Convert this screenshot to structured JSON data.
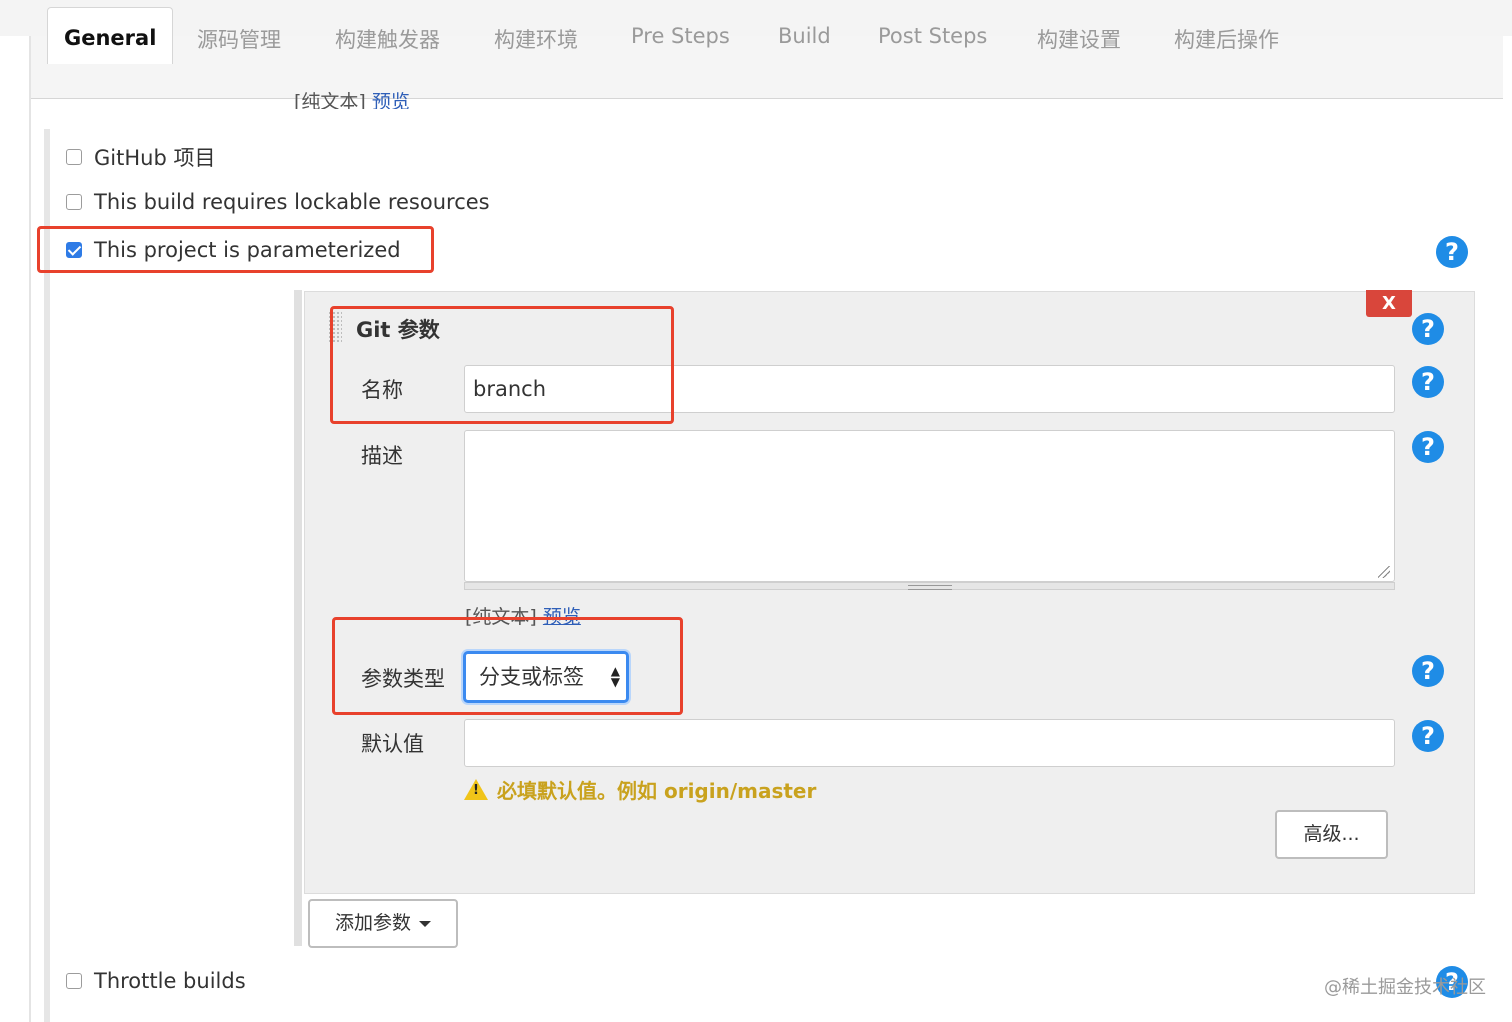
{
  "tabs": [
    {
      "label": "General",
      "active": true
    },
    {
      "label": "源码管理"
    },
    {
      "label": "构建触发器"
    },
    {
      "label": "构建环境"
    },
    {
      "label": "Pre Steps"
    },
    {
      "label": "Build"
    },
    {
      "label": "Post Steps"
    },
    {
      "label": "构建设置"
    },
    {
      "label": "构建后操作"
    }
  ],
  "description_footer": {
    "plain_text": "[纯文本]",
    "preview_link": "预览"
  },
  "options": {
    "github_project": {
      "label": "GitHub 项目",
      "checked": false
    },
    "lockable_resources": {
      "label": "This build requires lockable resources",
      "checked": false
    },
    "parameterized": {
      "label": "This project is parameterized",
      "checked": true
    },
    "throttle_builds": {
      "label": "Throttle builds",
      "checked": false
    }
  },
  "git_parameter": {
    "title": "Git 参数",
    "delete_label": "X",
    "name_label": "名称",
    "name_value": "branch",
    "description_label": "描述",
    "description_value": "",
    "plain_text": "[纯文本]",
    "preview_link": "预览",
    "type_label": "参数类型",
    "type_value": "分支或标签",
    "default_label": "默认值",
    "default_value": "",
    "warning": "必填默认值。例如 origin/master",
    "advanced_button": "高级..."
  },
  "add_parameter_button": "添加参数",
  "help_symbol": "?",
  "watermark": "@稀土掘金技术社区",
  "colors": {
    "highlight": "#e8412c",
    "help": "#1f8ce6",
    "link": "#2f5fb8",
    "warning": "#c9a21e",
    "delete": "#d9463b"
  }
}
